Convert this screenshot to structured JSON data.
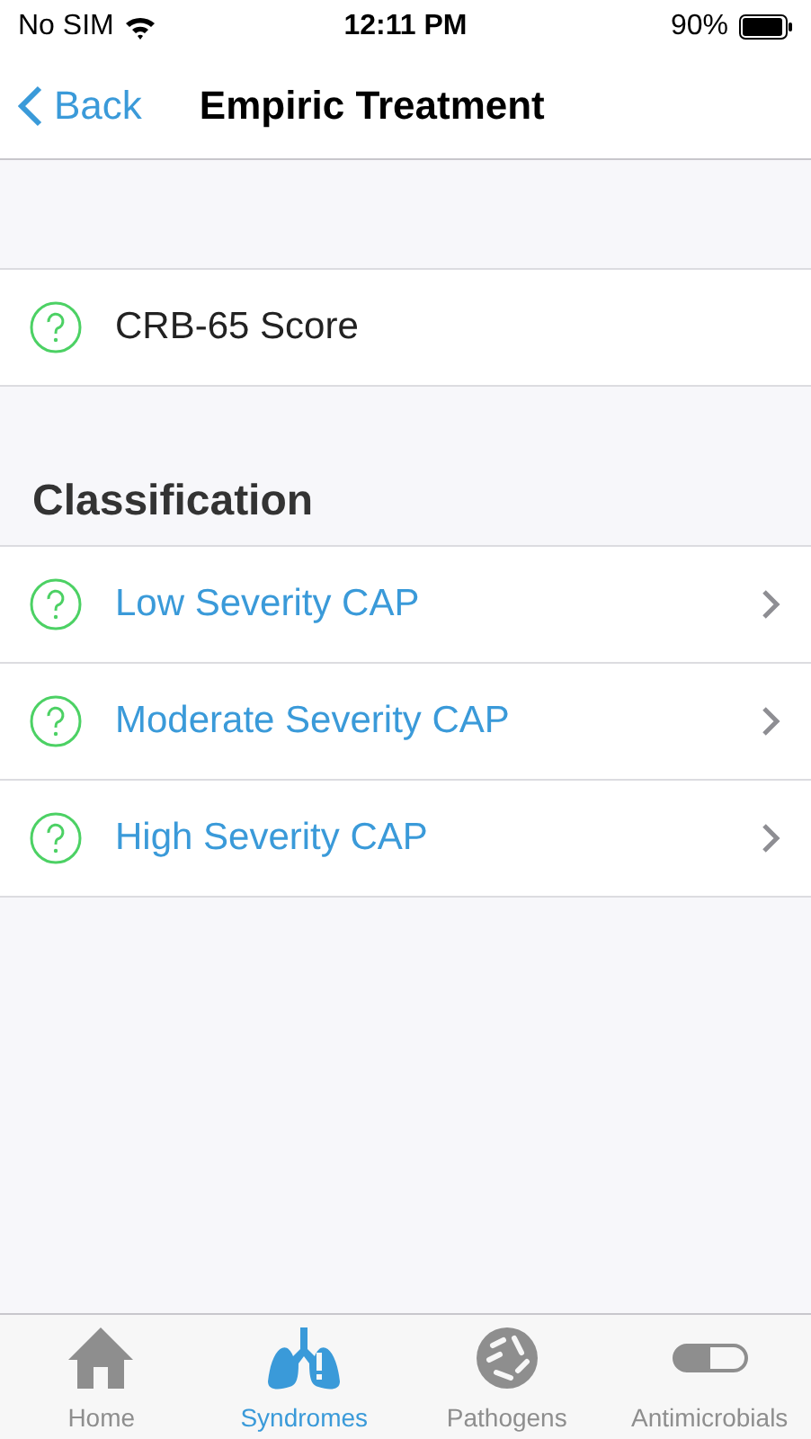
{
  "status_bar": {
    "carrier": "No SIM",
    "time": "12:11 PM",
    "battery": "90%"
  },
  "nav": {
    "back": "Back",
    "title": "Empiric Treatment"
  },
  "sections": [
    {
      "rows": [
        {
          "label": "CRB-65 Score",
          "kind": "info"
        }
      ]
    },
    {
      "header": "Classification",
      "rows": [
        {
          "label": "Low Severity CAP",
          "kind": "link"
        },
        {
          "label": "Moderate Severity CAP",
          "kind": "link"
        },
        {
          "label": "High Severity CAP",
          "kind": "link"
        }
      ]
    }
  ],
  "tabs": [
    {
      "label": "Home",
      "selected": false
    },
    {
      "label": "Syndromes",
      "selected": true
    },
    {
      "label": "Pathogens",
      "selected": false
    },
    {
      "label": "Antimicrobials",
      "selected": false
    }
  ]
}
